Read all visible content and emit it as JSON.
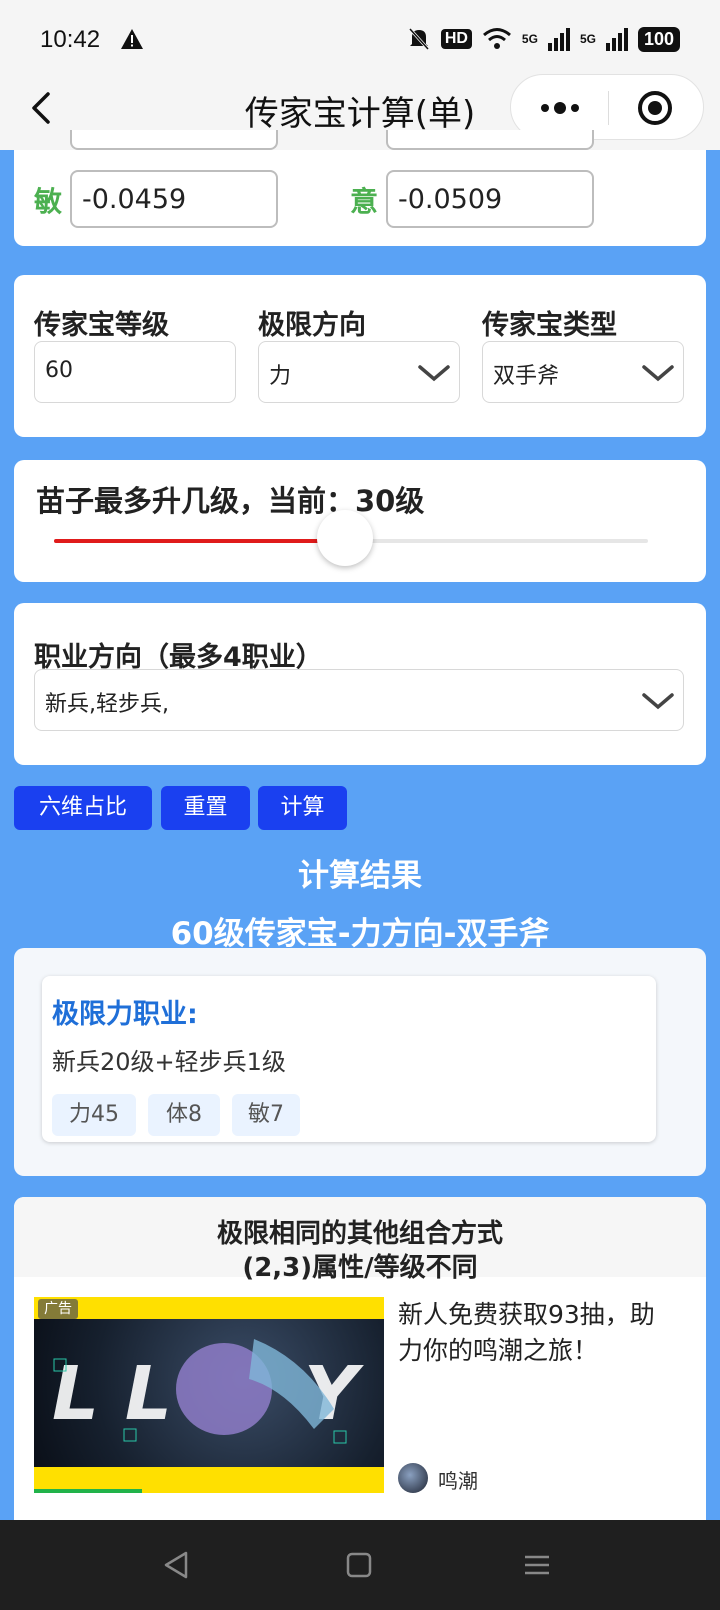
{
  "status_bar": {
    "time": "10:42",
    "battery": "100",
    "hd_label": "HD",
    "sim1": "5G",
    "sim2": "5G"
  },
  "header": {
    "title": "传家宝计算(单)"
  },
  "attributes": {
    "min_label": "敏",
    "min_value": "-0.0459",
    "yi_label": "意",
    "yi_value": "-0.0509"
  },
  "config": {
    "level_label": "传家宝等级",
    "level_value": "60",
    "direction_label": "极限方向",
    "direction_value": "力",
    "type_label": "传家宝类型",
    "type_value": "双手斧"
  },
  "slider": {
    "title": "苗子最多升几级，当前：30级",
    "fraction": 0.49
  },
  "profession": {
    "label": "职业方向（最多4职业）",
    "value": "新兵,轻步兵,"
  },
  "buttons": {
    "ratio": "六维占比",
    "reset": "重置",
    "calc": "计算"
  },
  "result": {
    "heading": "计算结果",
    "subheading": "60级传家宝-力方向-双手斧",
    "job_title": "极限力职业:",
    "combo": "新兵20级+轻步兵1级",
    "tags": [
      "力45",
      "体8",
      "敏7"
    ]
  },
  "others": {
    "title_line1": "极限相同的其他组合方式",
    "title_line2": "(2,3)属性/等级不同"
  },
  "ad": {
    "tag": "广告",
    "text": "新人免费获取93抽，助力你的鸣潮之旅！",
    "brand": "鸣潮"
  },
  "colors": {
    "accent_green": "#4cb050",
    "button_blue": "#1a40f0",
    "page_bg": "#5aa2f5",
    "result_blue": "#1f6fd8",
    "slider_red": "#e01b1b"
  }
}
